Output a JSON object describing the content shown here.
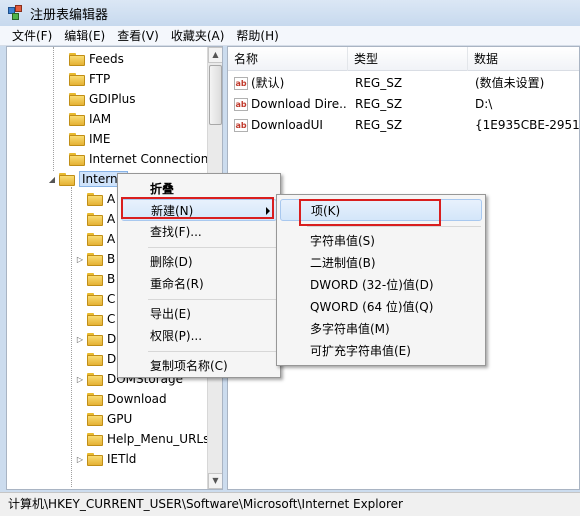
{
  "window": {
    "title": "注册表编辑器"
  },
  "menubar": [
    "文件(F)",
    "编辑(E)",
    "查看(V)",
    "收藏夹(A)",
    "帮助(H)"
  ],
  "tree": {
    "items": [
      "Feeds",
      "FTP",
      "GDIPlus",
      "IAM",
      "IME",
      "Internet Connection",
      "Internet Explorer",
      "A",
      "A",
      "A",
      "B",
      "B",
      "C",
      "C",
      "D",
      "D",
      "DOMStorage",
      "Download",
      "GPU",
      "Help_Menu_URLs",
      "IETld"
    ],
    "selected_visible_text": "Interne"
  },
  "list": {
    "headers": [
      "名称",
      "类型",
      "数据"
    ],
    "rows": [
      {
        "name": "(默认)",
        "type": "REG_SZ",
        "data": "(数值未设置)"
      },
      {
        "name": "Download Dire...",
        "type": "REG_SZ",
        "data": "D:\\"
      },
      {
        "name": "DownloadUI",
        "type": "REG_SZ",
        "data": "{1E935CBE-2951-4"
      }
    ]
  },
  "context_menu": {
    "collapse": "折叠",
    "new": "新建(N)",
    "find": "查找(F)...",
    "delete": "删除(D)",
    "rename": "重命名(R)",
    "export": "导出(E)",
    "permissions": "权限(P)...",
    "copy_key_name": "复制项名称(C)"
  },
  "submenu": {
    "key": "项(K)",
    "string": "字符串值(S)",
    "binary": "二进制值(B)",
    "dword": "DWORD (32-位)值(D)",
    "qword": "QWORD (64 位)值(Q)",
    "multi_string": "多字符串值(M)",
    "expandable_string": "可扩充字符串值(E)"
  },
  "statusbar": {
    "path": "计算机\\HKEY_CURRENT_USER\\Software\\Microsoft\\Internet Explorer"
  },
  "colors": {
    "highlight_box": "#d91e1e",
    "selection": "#cfe3fb"
  }
}
